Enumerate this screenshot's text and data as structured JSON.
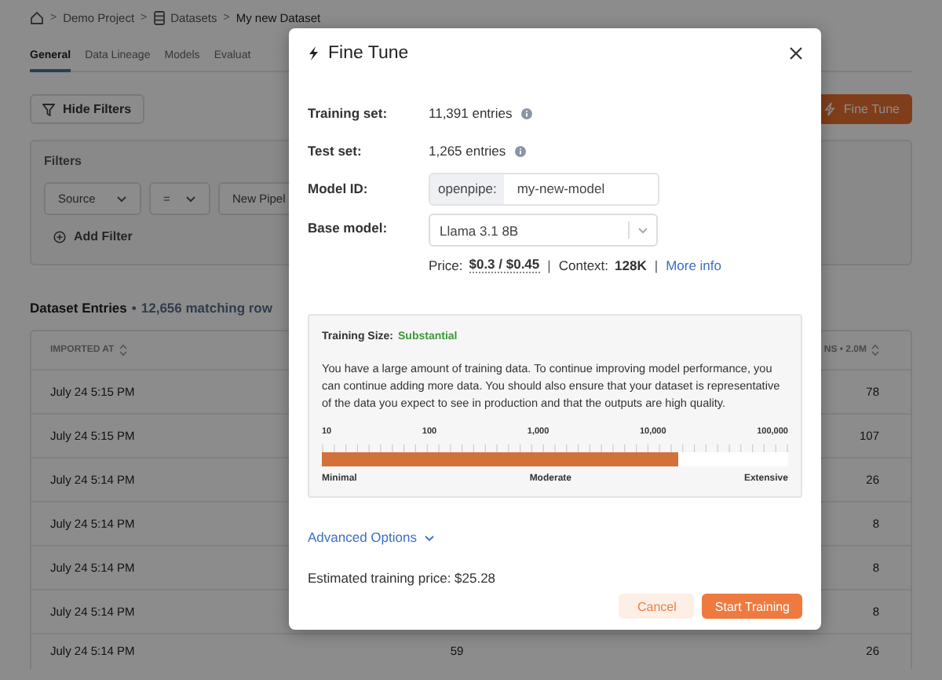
{
  "breadcrumb": [
    {
      "separator": ">",
      "label": "Demo Project"
    },
    {
      "separator": ">",
      "label": "Datasets"
    },
    {
      "separator": ">",
      "label": "My new Dataset"
    }
  ],
  "tabs": [
    {
      "label": "General",
      "selected": true
    },
    {
      "label": "Data Lineage",
      "selected": false
    },
    {
      "label": "Models",
      "selected": false
    },
    {
      "label": "Evaluat",
      "selected": false
    }
  ],
  "hide_filters_button": "Hide Filters",
  "fine_tune_button": "Fine Tune",
  "filters": {
    "title": "Filters",
    "field": "Source",
    "operator": "=",
    "value": "New Pipel",
    "add_filter": "Add Filter"
  },
  "entries": {
    "title": "Dataset Entries",
    "separator": "•",
    "count": "12,656 matching row"
  },
  "table": {
    "columns": [
      {
        "label": "IMPORTED AT"
      },
      {
        "label": "NS • 2.0M"
      }
    ],
    "rows": [
      {
        "column_1": "July 24 5:15 PM",
        "column_3": "78"
      },
      {
        "column_1": "July 24 5:15 PM",
        "column_3": "107"
      },
      {
        "column_1": "July 24 5:14 PM",
        "column_3": "26"
      },
      {
        "column_1": "July 24 5:14 PM",
        "column_3": "8"
      },
      {
        "column_1": "July 24 5:14 PM",
        "column_3": "8"
      },
      {
        "column_1": "July 24 5:14 PM",
        "column_3": "8"
      },
      {
        "column_1": "July 24 5:14 PM",
        "column_2": "59",
        "column_3": "26"
      }
    ]
  },
  "modal": {
    "title": "Fine Tune",
    "fields": [
      {
        "kind": "text",
        "label": "Training set:",
        "value": "11,391 entries",
        "info": true
      },
      {
        "kind": "text",
        "label": "Test set:",
        "value": "1,265 entries",
        "info": true
      },
      {
        "kind": "prefixed",
        "label": "Model ID:",
        "prefix": "openpipe:",
        "value": "my-new-model"
      },
      {
        "kind": "select",
        "label": "Base model:",
        "value": "Llama 3.1 8B"
      }
    ],
    "price": {
      "label": "Price:",
      "price": "$0.3 / $0.45",
      "separator_1": "|",
      "context_label": "Context:",
      "context": "128K",
      "separator_2": "|",
      "link": "More info"
    },
    "training_size": {
      "label": "Training Size:",
      "rating": "Substantial",
      "description": "You have a large amount of training data. To continue improving model performance, you can continue adding more data. You should also ensure that your dataset is representative of the data you expect to see in production and that the outputs are high quality.",
      "scale": [
        "10",
        "100",
        "1,000",
        "10,000",
        "100,000"
      ],
      "level": 0.765,
      "bands": [
        "Minimal",
        "Moderate",
        "Extensive"
      ]
    },
    "advanced_options": "Advanced Options",
    "estimate": "Estimated training price: $25.28",
    "buttons": [
      {
        "label": "Cancel",
        "kind": "secondary"
      },
      {
        "label": "Start Training",
        "kind": "primary"
      }
    ]
  }
}
